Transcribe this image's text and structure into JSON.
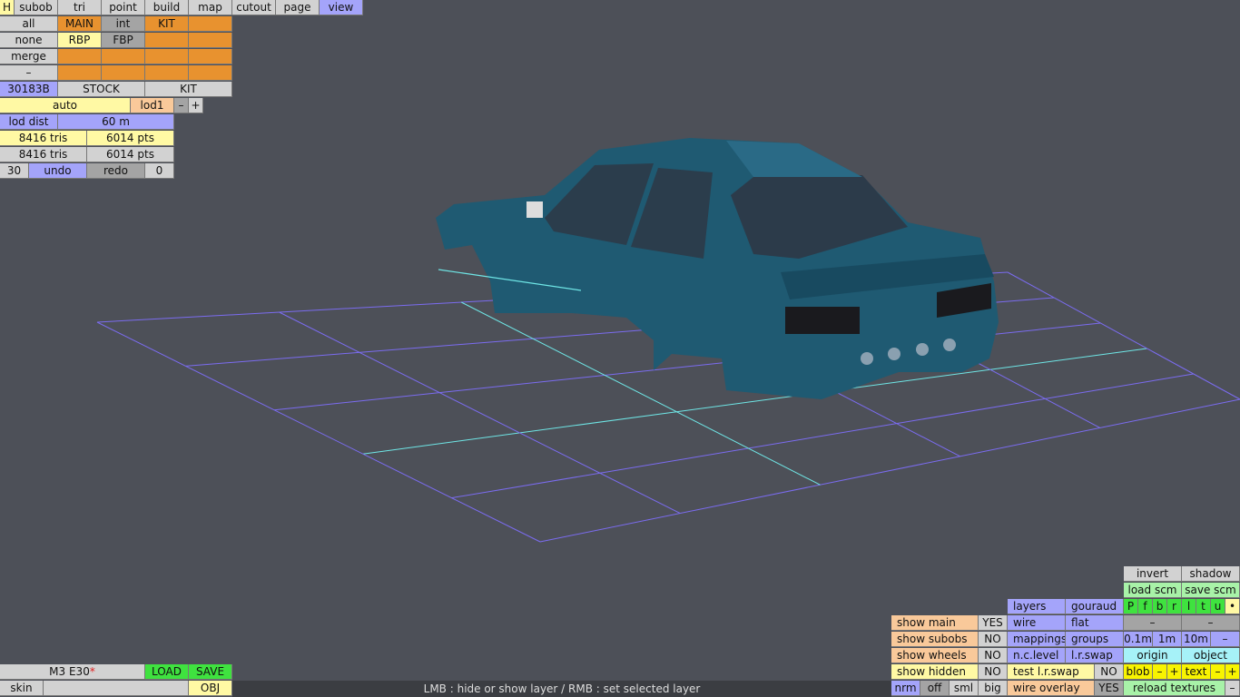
{
  "colors": {
    "background": "#4d5058",
    "gray": "#d2d2d2",
    "dark_gray": "#a4a4a4",
    "orange": "#e8922f",
    "blue": "#a4a4fa",
    "yellow": "#fff9a4",
    "peach": "#f9c99a",
    "green": "#3fe23f",
    "light_green": "#a8f2a8",
    "cyan": "#a6f2f8",
    "bright_yellow": "#f8f400",
    "grid": "#7b6cf0",
    "axis": "#6fe6e6",
    "car_body": "#1f5a72"
  },
  "top_menu": [
    "H",
    "subob",
    "tri",
    "point",
    "build",
    "map",
    "cutout",
    "page",
    "view"
  ],
  "layer_panel": {
    "side": [
      "all",
      "none",
      "merge",
      "–"
    ],
    "row1": [
      "MAIN",
      "int",
      "KIT",
      ""
    ],
    "row2": [
      "RBP",
      "FBP",
      "",
      ""
    ],
    "row3": [
      "",
      "",
      "",
      ""
    ],
    "row4": [
      "",
      "",
      "",
      ""
    ],
    "id": "30183B",
    "stock": "STOCK",
    "kit": "KIT"
  },
  "lod": {
    "mode": "auto",
    "level": "lod1",
    "minus": "–",
    "plus": "+",
    "dist_label": "lod dist",
    "dist_value": "60 m"
  },
  "stats": [
    {
      "tris": "8416 tris",
      "pts": "6014 pts"
    },
    {
      "tris": "8416 tris",
      "pts": "6014 pts"
    }
  ],
  "history": {
    "undo_count": "30",
    "undo": "undo",
    "redo": "redo",
    "redo_count": "0"
  },
  "file": {
    "name": "M3 E30",
    "modified_mark": "*",
    "load": "LOAD",
    "save": "SAVE",
    "skin": "skin",
    "skin_value": "",
    "obj": "OBJ"
  },
  "status_text": "LMB : hide or show layer / RMB : set selected layer",
  "view_panel": {
    "invert": "invert",
    "shadow": "shadow",
    "load_scm": "load scm",
    "save_scm": "save scm",
    "layers": "layers",
    "gouraud": "gouraud",
    "views": [
      "P",
      "f",
      "b",
      "r",
      "l",
      "t",
      "u",
      "•"
    ],
    "show": [
      {
        "label": "show main",
        "value": "YES"
      },
      {
        "label": "show subobs",
        "value": "NO"
      },
      {
        "label": "show wheels",
        "value": "NO"
      },
      {
        "label": "show hidden",
        "value": "NO"
      }
    ],
    "wire": "wire",
    "flat": "flat",
    "mappings": "mappings",
    "groups": "groups",
    "nc_level": "n.c.level",
    "lr_swap": "l.r.swap",
    "test_lr_swap": "test l.r.swap",
    "test_lr_swap_value": "NO",
    "wire_overlay": "wire overlay",
    "wire_overlay_value": "YES",
    "dash1": "–",
    "dash2": "–",
    "grid_sizes": [
      "0.1m",
      "1m",
      "10m",
      "–"
    ],
    "origin": "origin",
    "object": "object",
    "blob": "blob",
    "blob_minus": "–",
    "blob_plus": "+",
    "text": "text",
    "text_minus": "–",
    "text_plus": "+",
    "reload_textures": "reload textures",
    "reload_minus": "–",
    "size_modes": [
      "nrm",
      "off",
      "sml",
      "big"
    ]
  }
}
